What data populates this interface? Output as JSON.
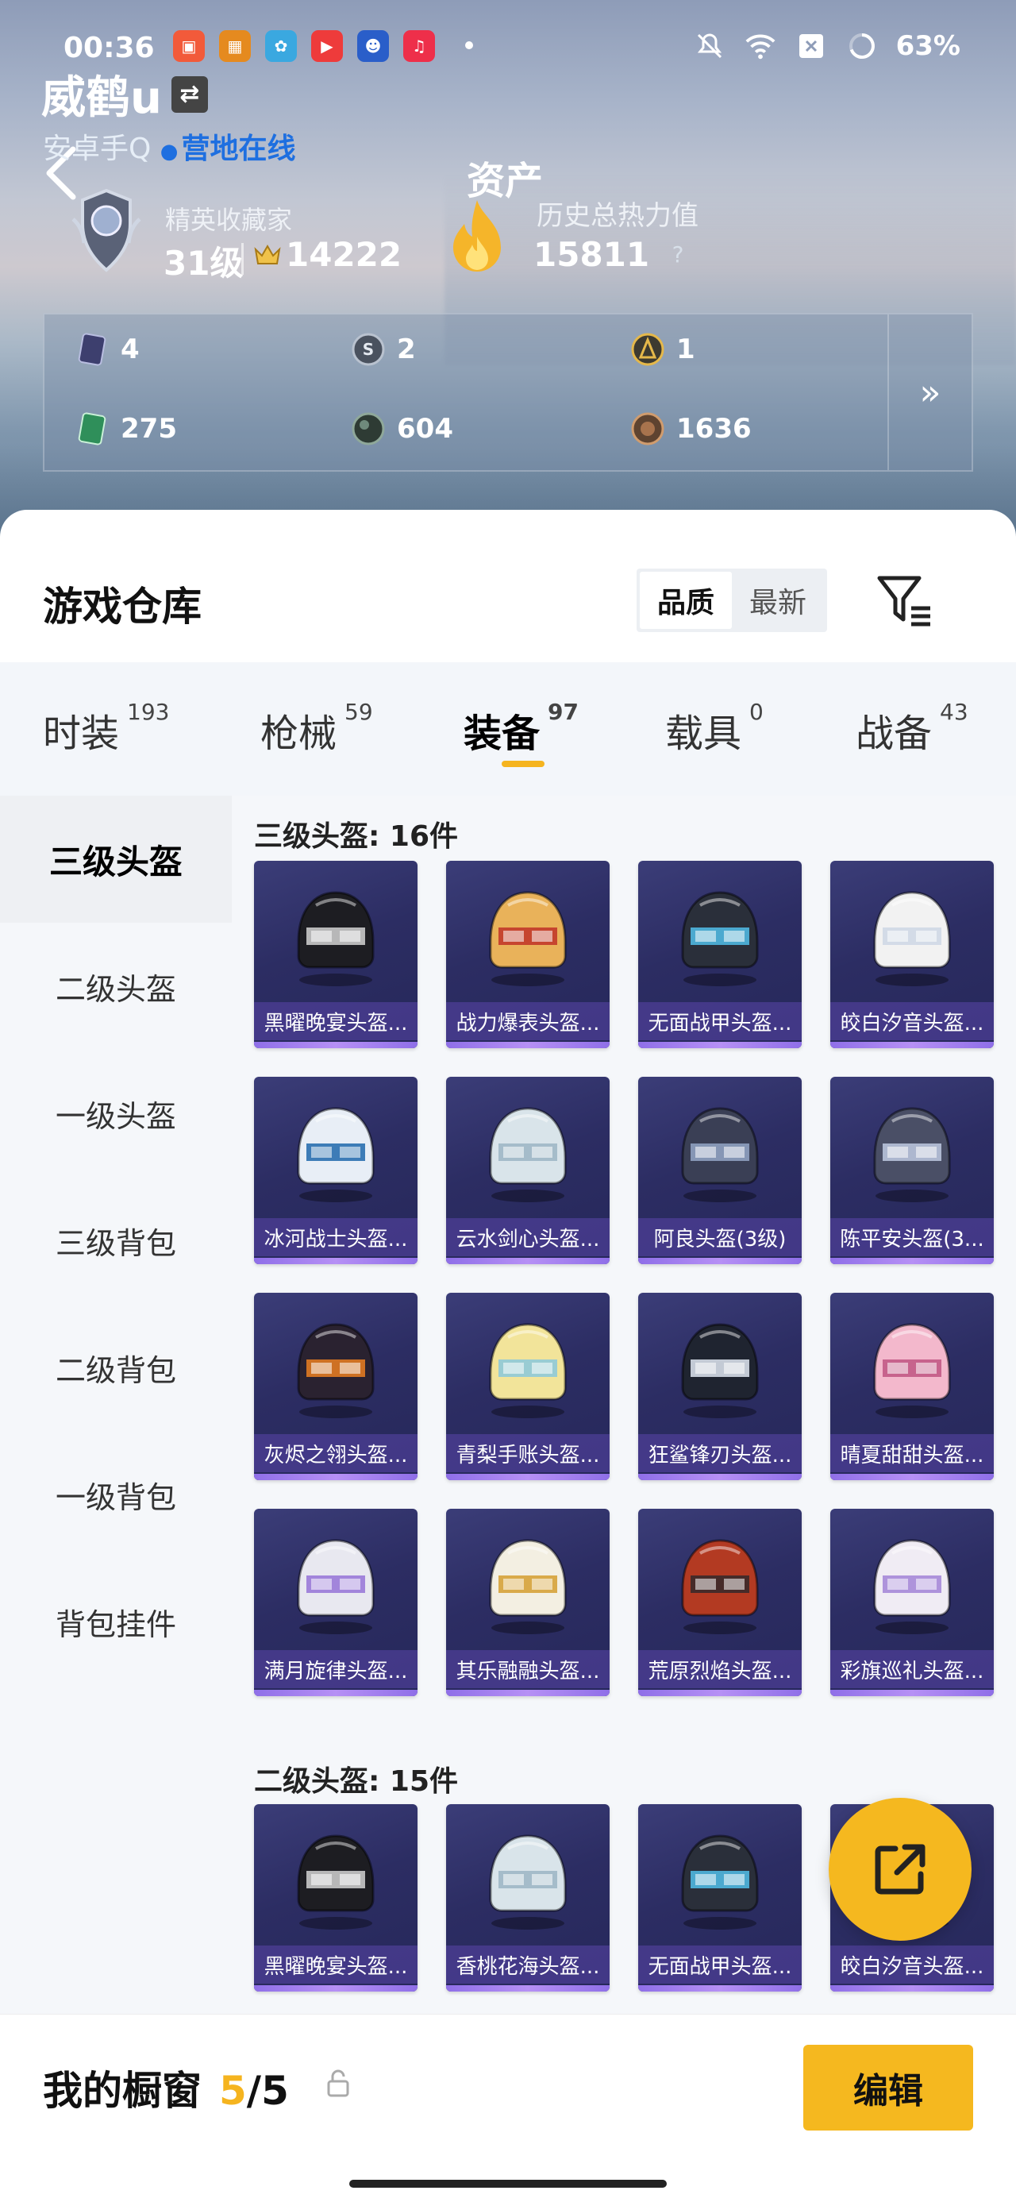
{
  "status_bar": {
    "time": "00:36",
    "battery": "63%",
    "app_icons": [
      "photos-app-icon",
      "game-assistant-icon",
      "gallery-icon",
      "video-app-icon",
      "game-icon",
      "music-app-icon"
    ]
  },
  "profile": {
    "name": "威鹤u",
    "account_type": "安卓手Q",
    "online_status": "营地在线",
    "rank_title": "精英收藏家",
    "rank_level": "31级",
    "rank_points": "14222",
    "assets_label": "资产",
    "heat_title": "历史总热力值",
    "heat_value": "15811",
    "heat_help": "?"
  },
  "stats": [
    {
      "icon": "card-icon",
      "value": "4"
    },
    {
      "icon": "silver-coin-icon",
      "value": "2"
    },
    {
      "icon": "gold-coin-icon",
      "value": "1"
    },
    {
      "icon": "green-ticket-icon",
      "value": "275"
    },
    {
      "icon": "dark-orb-icon",
      "value": "604"
    },
    {
      "icon": "bronze-coin-icon",
      "value": "1636"
    }
  ],
  "warehouse": {
    "title": "游戏仓库",
    "sort_quality": "品质",
    "sort_newest": "最新"
  },
  "tabs": [
    {
      "label": "时装",
      "count": "193"
    },
    {
      "label": "枪械",
      "count": "59"
    },
    {
      "label": "装备",
      "count": "97"
    },
    {
      "label": "载具",
      "count": "0"
    },
    {
      "label": "战备",
      "count": "43"
    }
  ],
  "sidebar": [
    "三级头盔",
    "二级头盔",
    "一级头盔",
    "三级背包",
    "二级背包",
    "一级背包",
    "背包挂件"
  ],
  "sections": [
    {
      "title": "三级头盔: 16件",
      "items": [
        "黑曜晚宴头盔...",
        "战力爆表头盔...",
        "无面战甲头盔...",
        "皎白汐音头盔...",
        "冰河战士头盔...",
        "云水剑心头盔...",
        "阿良头盔(3级)",
        "陈平安头盔(3...",
        "灰烬之翎头盔...",
        "青梨手账头盔...",
        "狂鲨锋刃头盔...",
        "晴夏甜甜头盔...",
        "满月旋律头盔...",
        "其乐融融头盔...",
        "荒原烈焰头盔...",
        "彩旗巡礼头盔..."
      ]
    },
    {
      "title": "二级头盔: 15件",
      "items": [
        "黑曜晚宴头盔...",
        "香桃花海头盔...",
        "无面战甲头盔...",
        "皎白汐音头盔..."
      ]
    }
  ],
  "bottom": {
    "showcase_label": "我的橱窗",
    "showcase_used": "5",
    "showcase_sep": "/",
    "showcase_total": "5",
    "edit_label": "编辑"
  },
  "colors": {
    "accent": "#f5b81f",
    "online_blue": "#1e6fe0",
    "card_purple": "#2c2d63"
  }
}
